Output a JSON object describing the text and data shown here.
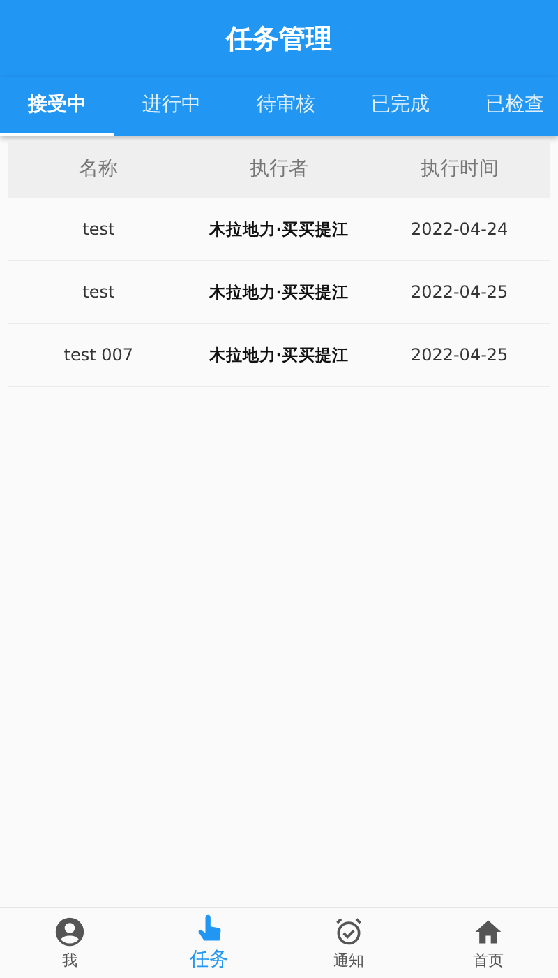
{
  "header": {
    "title": "任务管理"
  },
  "tabs": [
    {
      "label": "接受中",
      "selected": true
    },
    {
      "label": "进行中",
      "selected": false
    },
    {
      "label": "待审核",
      "selected": false
    },
    {
      "label": "已完成",
      "selected": false
    },
    {
      "label": "已检查",
      "selected": false
    }
  ],
  "table": {
    "columns": [
      "名称",
      "执行者",
      "执行时间"
    ],
    "rows": [
      [
        "test",
        "木拉地力·买买提江",
        "2022-04-24"
      ],
      [
        "test",
        "木拉地力·买买提江",
        "2022-04-25"
      ],
      [
        "test 007",
        "木拉地力·买买提江",
        "2022-04-25"
      ]
    ]
  },
  "bottom_nav": [
    {
      "kind": "profile",
      "label": "我",
      "selected": false
    },
    {
      "kind": "task",
      "label": "任务",
      "selected": true
    },
    {
      "kind": "alarm",
      "label": "通知",
      "selected": false
    },
    {
      "kind": "home",
      "label": "首页",
      "selected": false
    }
  ]
}
